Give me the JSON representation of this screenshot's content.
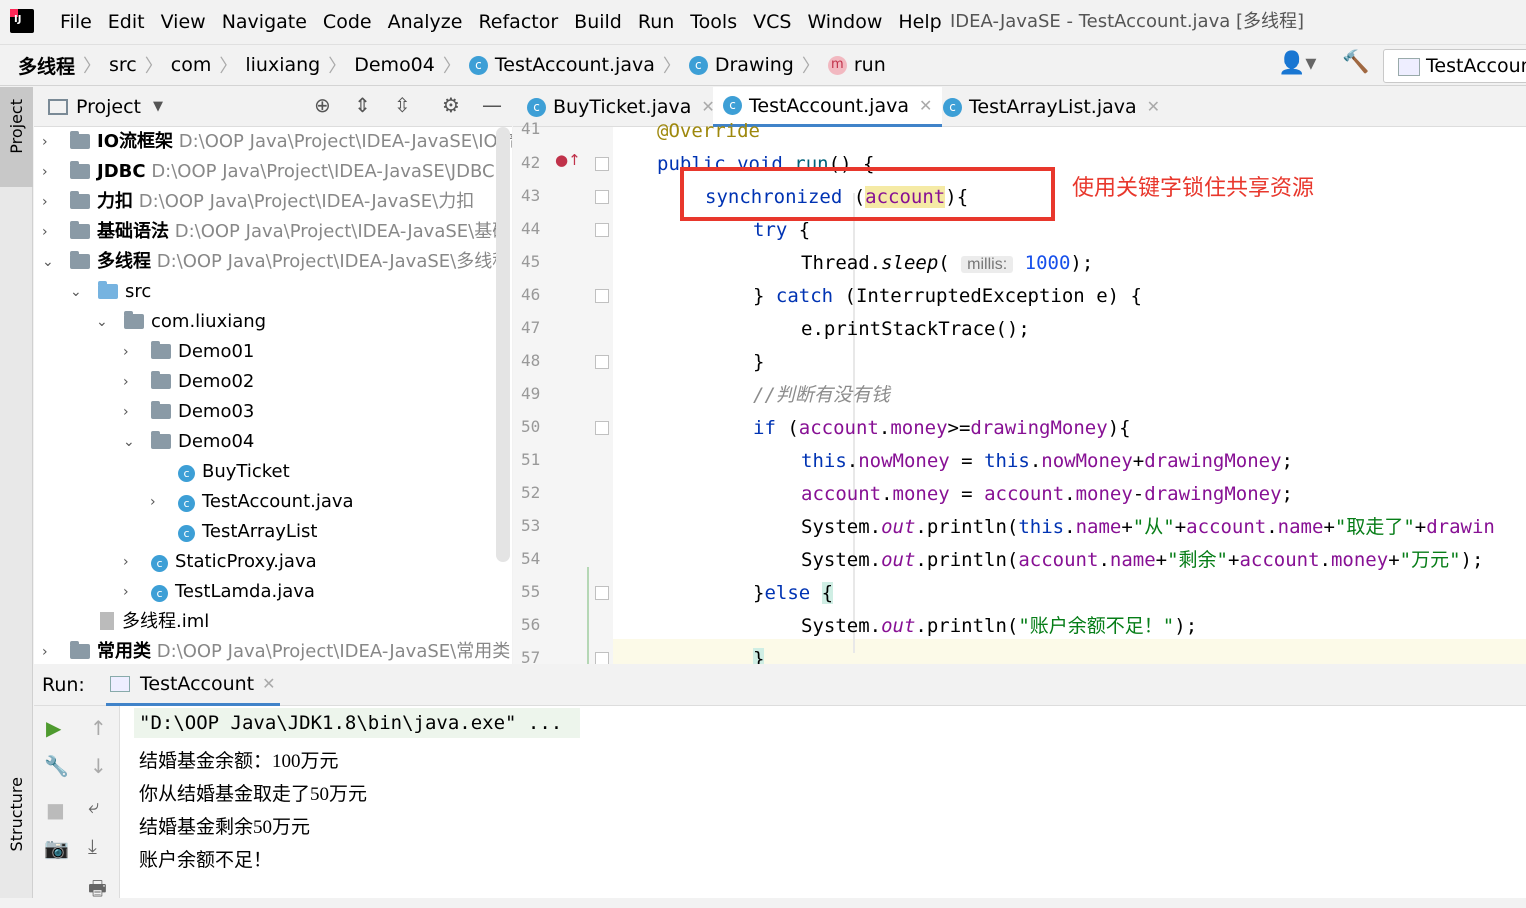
{
  "menubar": {
    "items": [
      "File",
      "Edit",
      "View",
      "Navigate",
      "Code",
      "Analyze",
      "Refactor",
      "Build",
      "Run",
      "Tools",
      "VCS",
      "Window",
      "Help"
    ],
    "window_title": "IDEA-JavaSE - TestAccount.java [多线程]"
  },
  "breadcrumb": [
    "多线程",
    "src",
    "com",
    "liuxiang",
    "Demo04",
    "TestAccount.java",
    "Drawing",
    "run"
  ],
  "run_config": "TestAccount",
  "sidebar_tabs": {
    "project": "Project",
    "structure": "Structure"
  },
  "project": {
    "title": "Project",
    "tree": [
      {
        "name": "IO流框架",
        "path": "D:\\OOP Java\\Project\\IDEA-JavaSE\\IO流"
      },
      {
        "name": "JDBC",
        "path": "D:\\OOP Java\\Project\\IDEA-JavaSE\\JDBC"
      },
      {
        "name": "力扣",
        "path": "D:\\OOP Java\\Project\\IDEA-JavaSE\\力扣"
      },
      {
        "name": "基础语法",
        "path": "D:\\OOP Java\\Project\\IDEA-JavaSE\\基础"
      },
      {
        "name": "多线程",
        "path": "D:\\OOP Java\\Project\\IDEA-JavaSE\\多线程"
      },
      {
        "name": "src"
      },
      {
        "name": "com.liuxiang"
      },
      {
        "name": "Demo01"
      },
      {
        "name": "Demo02"
      },
      {
        "name": "Demo03"
      },
      {
        "name": "Demo04"
      },
      {
        "name": "BuyTicket"
      },
      {
        "name": "TestAccount.java"
      },
      {
        "name": "TestArrayList"
      },
      {
        "name": "StaticProxy.java"
      },
      {
        "name": "TestLamda.java"
      },
      {
        "name": "多线程.iml"
      },
      {
        "name": "常用类",
        "path": "D:\\OOP Java\\Project\\IDEA-JavaSE\\常用类"
      }
    ]
  },
  "editor": {
    "tabs": [
      "BuyTicket.java",
      "TestAccount.java",
      "TestArrayList.java"
    ],
    "active_tab": "TestAccount.java",
    "line_numbers": [
      "41",
      "42",
      "43",
      "44",
      "45",
      "46",
      "47",
      "48",
      "49",
      "50",
      "51",
      "52",
      "53",
      "54",
      "55",
      "56",
      "57"
    ],
    "param_hint": "millis:",
    "annotation": "使用关键字锁住共享资源"
  },
  "run": {
    "label": "Run:",
    "tab": "TestAccount",
    "output": [
      "\"D:\\OOP Java\\JDK1.8\\bin\\java.exe\" ...",
      "结婚基金余额：100万元",
      "你从结婚基金取走了50万元",
      "结婚基金剩余50万元",
      "账户余额不足！"
    ]
  },
  "colors": {
    "keyword": "#0033b3",
    "field": "#871094",
    "string": "#067d17",
    "comment": "#8c8c8c",
    "number": "#1750eb",
    "annotation": "#e8372c"
  }
}
